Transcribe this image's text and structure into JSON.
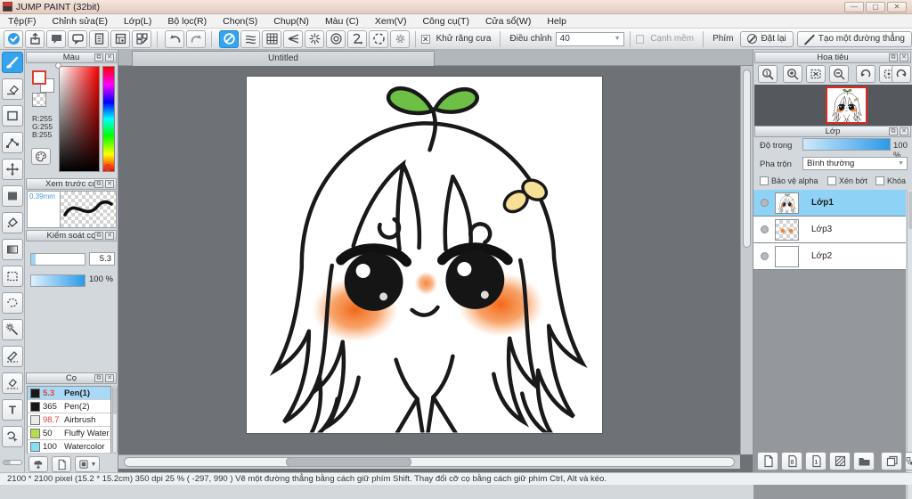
{
  "window": {
    "title": "JUMP PAINT (32bit)"
  },
  "menu": {
    "items": [
      "Tệp(F)",
      "Chỉnh sửa(E)",
      "Lớp(L)",
      "Bộ lọc(R)",
      "Chọn(S)",
      "Chụp(N)",
      "Màu (C)",
      "Xem(V)",
      "Công cụ(T)",
      "Cửa sổ(W)",
      "Help"
    ]
  },
  "toolbar": {
    "antialias_label": "Khử răng cưa",
    "adjust_label": "Điều chỉnh",
    "adjust_value": "40",
    "soft_edge_label": "Cạnh mềm",
    "key_label": "Phím",
    "reset_label": "Đặt lại",
    "straight_line_label": "Tạo một đường thẳng"
  },
  "color_panel": {
    "title": "Màu",
    "r_value": "R:255",
    "g_value": "G:255",
    "b_value": "B:255"
  },
  "brush_preview_panel": {
    "title": "Xem trước cọ",
    "brush_size": "0.39mm"
  },
  "brush_control_panel": {
    "title": "Kiểm soát cọ",
    "size_value": "5.3",
    "opacity_value": "100 %"
  },
  "brush_panel": {
    "title": "Cọ",
    "brushes": [
      {
        "size": "5.3",
        "name": "Pen(1)",
        "swatch": "#181818"
      },
      {
        "size": "365",
        "name": "Pen(2)",
        "swatch": "#181818"
      },
      {
        "size": "98.7",
        "name": "Airbrush",
        "swatch": "#ececec"
      },
      {
        "size": "50",
        "name": "Fluffy Water",
        "swatch": "#b5dc4d"
      },
      {
        "size": "100",
        "name": "Watercolor",
        "swatch": "#86dff2"
      }
    ]
  },
  "document": {
    "tab_title": "Untitled"
  },
  "navigator": {
    "title": "Hoa tiêu"
  },
  "layers_panel": {
    "title": "Lớp",
    "opacity_label": "Độ trong",
    "opacity_value": "100 %",
    "blend_label": "Pha trộn",
    "blend_value": "Bình thường",
    "protect_alpha_label": "Bảo vệ alpha",
    "clipping_label": "Xén bớt",
    "lock_label": "Khóa",
    "layers": [
      {
        "name": "Lớp1",
        "selected": true
      },
      {
        "name": "Lớp3",
        "selected": false
      },
      {
        "name": "Lớp2",
        "selected": false
      }
    ]
  },
  "status_bar": {
    "text": "2100 * 2100 pixel   (15.2 * 15.2cm)   350 dpi   25 %   ( -297, 990 )   Vẽ một đường thẳng bằng cách giữ phím Shift. Thay đổi cỡ cọ bằng cách giữ phím Ctrl, Alt và kéo."
  },
  "colors": {
    "accent_blue": "#36a3ef",
    "selection_blue": "#8ed2f5",
    "canvas_bg": "#6e7176",
    "blush_orange": "#f0751e",
    "leaf_green": "#6dbf45",
    "clip_yellow": "#f6e096",
    "fg_color_rgb": "255,255,255"
  }
}
